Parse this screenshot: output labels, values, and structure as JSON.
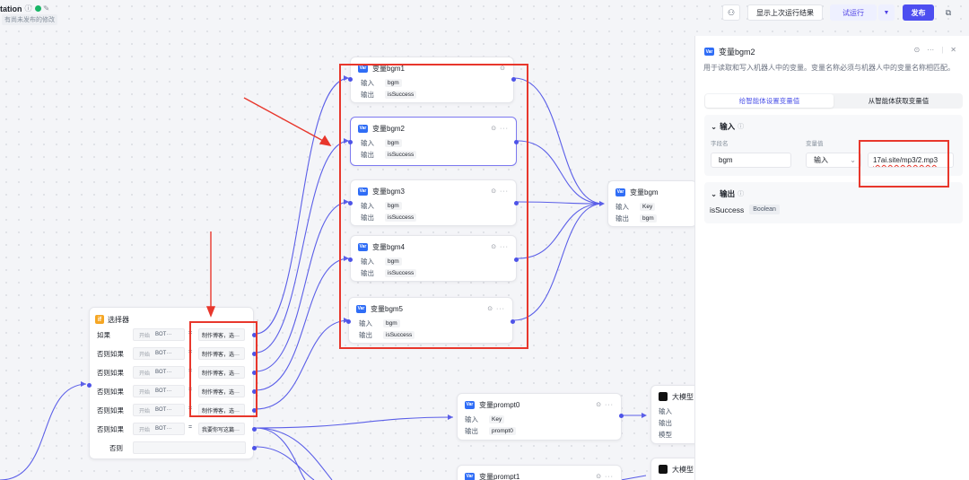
{
  "topbar": {
    "title": "tation",
    "unpublished": "有尚未发布的修改",
    "show_last_run": "显示上次运行结果",
    "test_run": "试运行",
    "publish": "发布"
  },
  "var_icon": "Var",
  "var_nodes": [
    {
      "title": "变量bgm1",
      "in_label": "输入",
      "in_value": "bgm",
      "out_label": "输出",
      "out_value": "isSuccess"
    },
    {
      "title": "变量bgm2",
      "in_label": "输入",
      "in_value": "bgm",
      "out_label": "输出",
      "out_value": "isSuccess"
    },
    {
      "title": "变量bgm3",
      "in_label": "输入",
      "in_value": "bgm",
      "out_label": "输出",
      "out_value": "isSuccess"
    },
    {
      "title": "变量bgm4",
      "in_label": "输入",
      "in_value": "bgm",
      "out_label": "输出",
      "out_value": "isSuccess"
    },
    {
      "title": "变量bgm5",
      "in_label": "输入",
      "in_value": "bgm",
      "out_label": "输出",
      "out_value": "isSuccess"
    }
  ],
  "bgm_node": {
    "title": "变量bgm",
    "in_label": "输入",
    "in_value": "Key",
    "out_label": "输出",
    "out_value": "bgm"
  },
  "prompt0_node": {
    "title": "变量prompt0",
    "in_label": "输入",
    "in_value": "Key",
    "out_label": "输出",
    "out_value": "prompt0"
  },
  "prompt1_node": {
    "title": "变量prompt1"
  },
  "llm_nodes": [
    {
      "title": "大模型",
      "row1": "输入",
      "row2": "输出",
      "row3": "模型"
    },
    {
      "title": "大模型"
    }
  ],
  "selector": {
    "title": "选择器",
    "icon": "if",
    "rows": [
      {
        "key": "如果",
        "start": "开始",
        "bot": "BOT···",
        "eq": "=",
        "value": "制作博客，选···"
      },
      {
        "key": "否则如果",
        "start": "开始",
        "bot": "BOT···",
        "eq": "=",
        "value": "制作博客，选···"
      },
      {
        "key": "否则如果",
        "start": "开始",
        "bot": "BOT···",
        "eq": "=",
        "value": "制作博客，选···"
      },
      {
        "key": "否则如果",
        "start": "开始",
        "bot": "BOT···",
        "eq": "=",
        "value": "制作博客，选···"
      },
      {
        "key": "否则如果",
        "start": "开始",
        "bot": "BOT···",
        "eq": "=",
        "value": "制作博客，选···"
      },
      {
        "key": "否则如果",
        "start": "开始",
        "bot": "BOT···",
        "eq": "=",
        "value": "我要你写这篇···"
      }
    ],
    "else_label": "否则"
  },
  "panel": {
    "title": "变量bgm2",
    "description": "用于读取和写入机器人中的变量。变量名称必须与机器人中的变量名称相匹配。",
    "tab_set": "给智能体设置变量值",
    "tab_get": "从智能体获取变量值",
    "input_section": "输入",
    "param_label": "字段名",
    "var_value_label": "变量值",
    "param_value": "bgm",
    "input_type": "输入",
    "url_value": "17ai.site/mp3/2.mp3",
    "output_section": "输出",
    "output_name": "isSuccess",
    "output_type": "Boolean"
  },
  "colors": {
    "accent": "#4d4ef0",
    "port": "#4d53e8",
    "annotation": "#e8372c",
    "var_icon": "#2f6df6"
  }
}
